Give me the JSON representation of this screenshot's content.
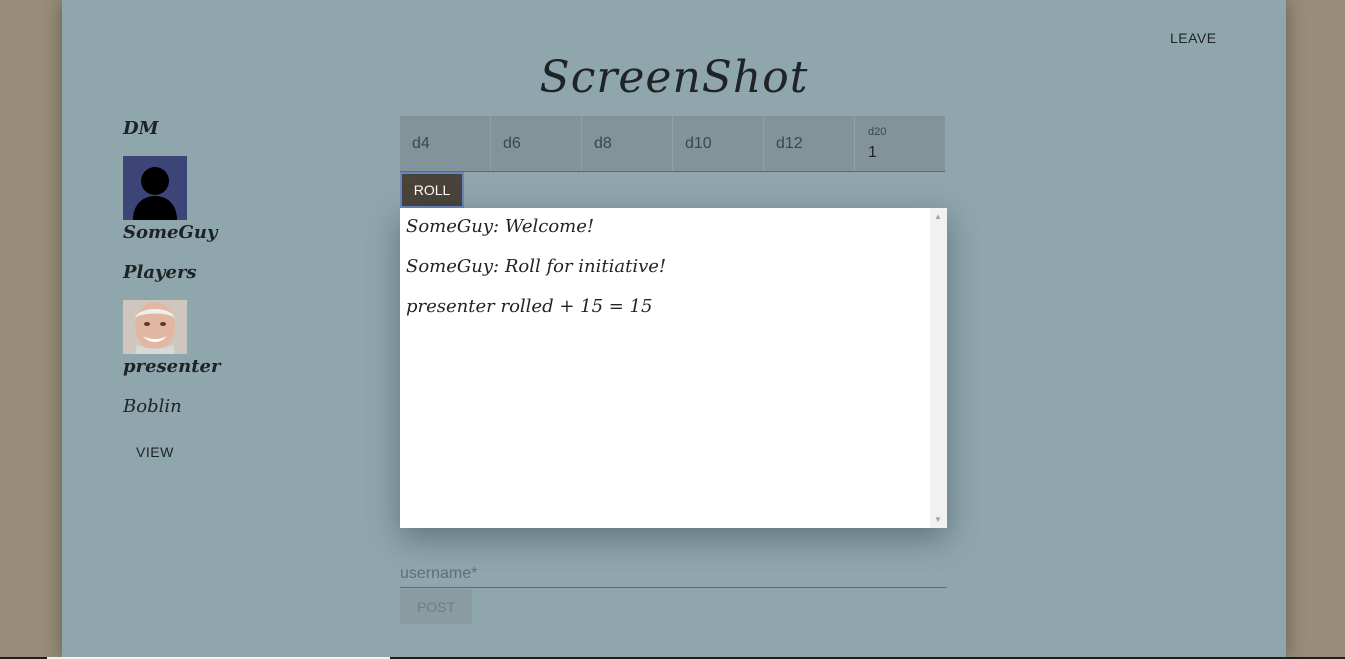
{
  "app": {
    "title": "ScreenShot",
    "leave_label": "LEAVE"
  },
  "sidebar": {
    "dm_heading": "DM",
    "dm_name": "SomeGuy",
    "players_heading": "Players",
    "players": [
      {
        "name": "presenter"
      },
      {
        "name": "Boblin"
      }
    ],
    "view_label": "VIEW"
  },
  "dice": {
    "items": [
      {
        "label": "d4"
      },
      {
        "label": "d6"
      },
      {
        "label": "d8"
      },
      {
        "label": "d10"
      },
      {
        "label": "d12"
      },
      {
        "label": "d20",
        "value": "1"
      }
    ],
    "roll_label": "ROLL"
  },
  "chat": {
    "messages": [
      "SomeGuy: Welcome!",
      "SomeGuy: Roll for initiative!",
      "presenter rolled + 15 = 15"
    ]
  },
  "composer": {
    "username_placeholder": "username*",
    "username_value": "",
    "post_label": "POST"
  },
  "colors": {
    "page_bg": "#978d78",
    "panel_bg": "#8fa6ad",
    "dice_bar_bg": "#82949a",
    "roll_button_bg": "#4a4339",
    "chat_bg": "#ffffff"
  }
}
